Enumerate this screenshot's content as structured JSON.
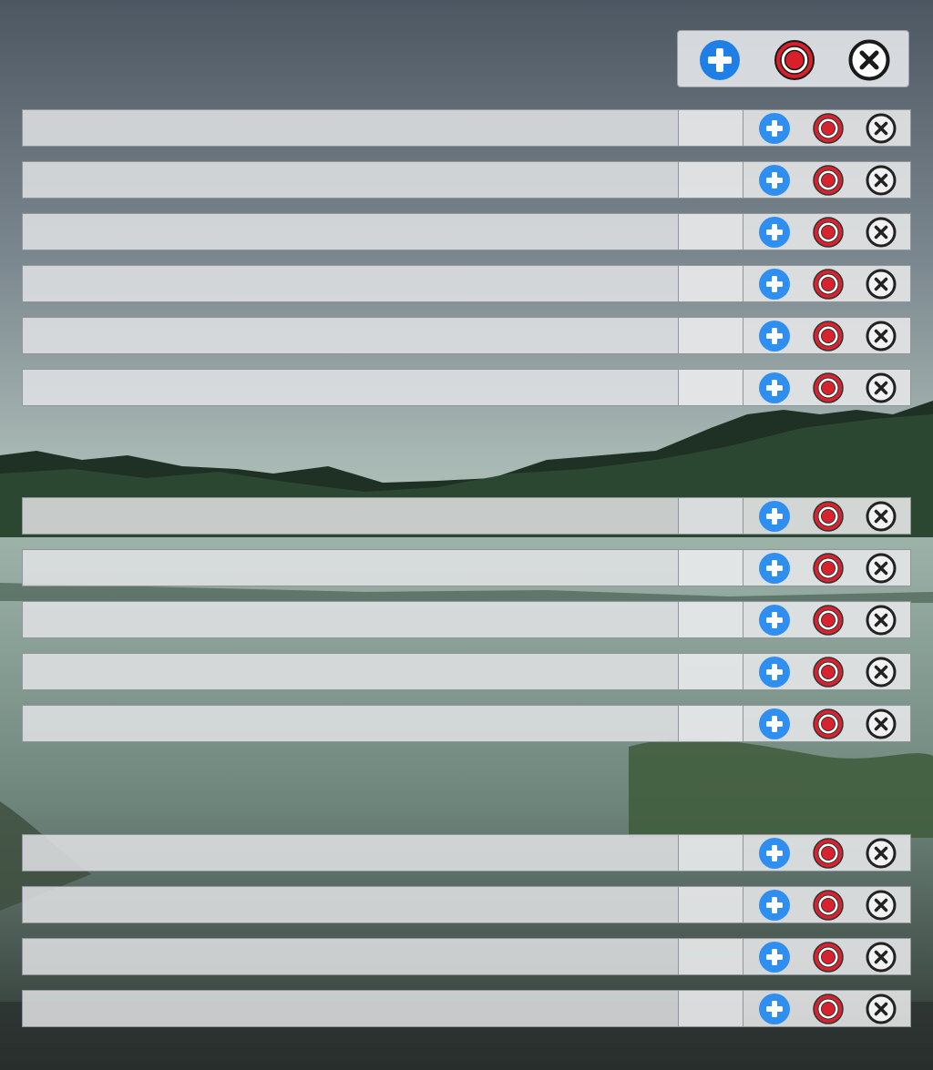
{
  "toolbar": {
    "buttons": [
      {
        "icon": "plus-icon",
        "color": "#1e7fe6"
      },
      {
        "icon": "record-icon",
        "color": "#d81f2a"
      },
      {
        "icon": "close-icon",
        "color": "#1a1a1a"
      }
    ]
  },
  "groups": [
    {
      "rows": [
        {
          "name": "",
          "value": ""
        },
        {
          "name": "",
          "value": ""
        },
        {
          "name": "",
          "value": ""
        },
        {
          "name": "",
          "value": ""
        },
        {
          "name": "",
          "value": ""
        },
        {
          "name": "",
          "value": ""
        }
      ]
    },
    {
      "rows": [
        {
          "name": "",
          "value": ""
        },
        {
          "name": "",
          "value": ""
        },
        {
          "name": "",
          "value": ""
        },
        {
          "name": "",
          "value": ""
        },
        {
          "name": "",
          "value": ""
        }
      ]
    },
    {
      "rows": [
        {
          "name": "",
          "value": ""
        },
        {
          "name": "",
          "value": ""
        },
        {
          "name": "",
          "value": ""
        },
        {
          "name": "",
          "value": ""
        }
      ]
    }
  ],
  "colors": {
    "add": "#2f8ff0",
    "record": "#d8232f",
    "close": "#222222",
    "row_fill": "#e1e2e4"
  }
}
